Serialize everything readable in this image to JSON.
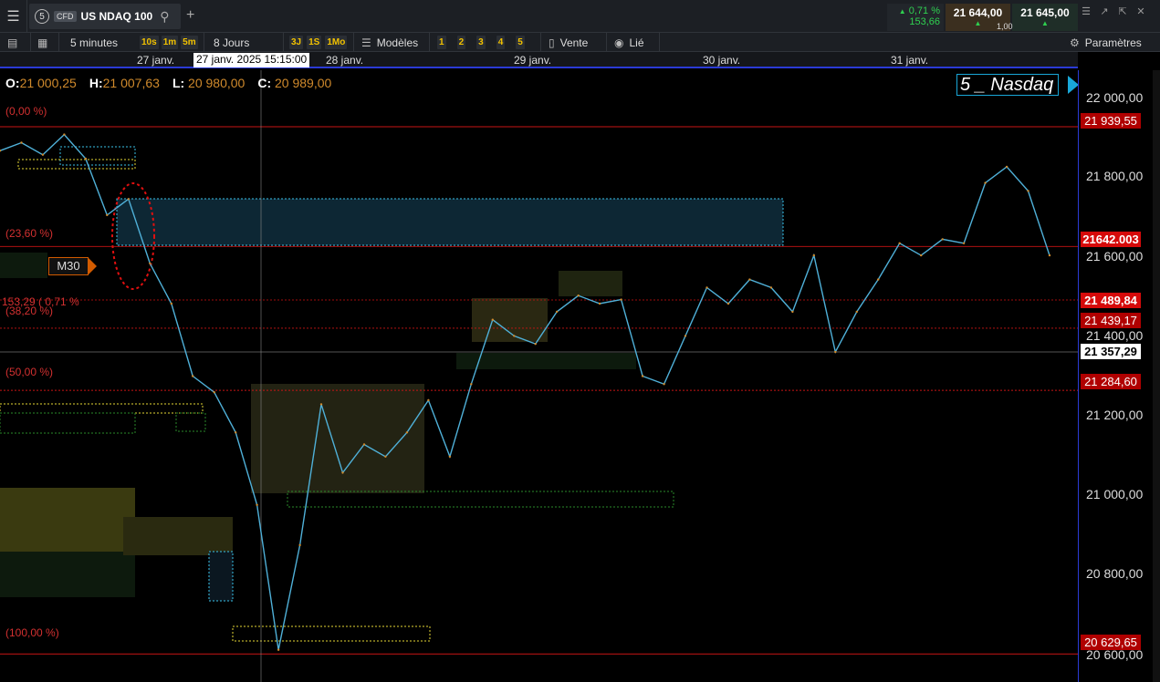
{
  "header": {
    "menu_icon": "hamburger-icon",
    "tab_number": "5",
    "tab_badge": "CFD",
    "instrument": "US NDAQ 100",
    "change_pct": "0,71 %",
    "change_pts": "153,66",
    "bid": "21 644,00",
    "ask": "21 645,00",
    "spread": "1,00"
  },
  "toolbar": {
    "interval": "5 minutes",
    "interval_shortcuts": [
      "10s",
      "1m",
      "5m"
    ],
    "period": "8 Jours",
    "period_shortcuts": [
      "3J",
      "1S",
      "1Mo"
    ],
    "templates": "Modèles",
    "template_slots": [
      "1",
      "2",
      "3",
      "4",
      "5"
    ],
    "sell": "Vente",
    "linked": "Lié",
    "settings": "Paramètres"
  },
  "date_axis": {
    "labels": [
      "27 janv.",
      "28 janv.",
      "29 janv.",
      "30 janv.",
      "31 janv."
    ],
    "cursor": "27 janv. 2025 15:15:00"
  },
  "ohlc": {
    "o_label": "O:",
    "o_value": "21 000,25",
    "h_label": "H:",
    "h_value": "21 007,63",
    "l_label": "L:",
    "l_value": "20 980,00",
    "c_label": "C:",
    "c_value": "20 989,00"
  },
  "annotations": {
    "watermark": "5 _  Nasdaq",
    "timeframe_tag": "M30",
    "change_label": "153,29 ( 0,71 %"
  },
  "fibonacci": [
    "(0,00 %)",
    "(23,60 %)",
    "(38,20 %)",
    "(50,00 %)",
    "(100,00 %)"
  ],
  "price_axis": {
    "ticks": [
      "22 000,00",
      "21 800,00",
      "21 600,00",
      "21 400,00",
      "21 200,00",
      "21 000,00",
      "20 800,00",
      "20 600,00"
    ],
    "tags": [
      "21 939,55",
      "21642.003",
      "21 489,84",
      "21 439,17",
      "21 357,29",
      "21 284,60",
      "20 629,65"
    ]
  },
  "chart_data": {
    "type": "line",
    "title": "US NDAQ 100",
    "interval": "5 minutes",
    "ylim": [
      20560,
      22080
    ],
    "x": [
      "27 janv.",
      "28 janv.",
      "29 janv.",
      "30 janv.",
      "31 janv."
    ],
    "series": [
      {
        "values": [
          21880,
          21900,
          21870,
          21920,
          21860,
          21720,
          21760,
          21600,
          21500,
          21320,
          21280,
          21180,
          21000,
          20640,
          20900,
          21250,
          21080,
          21150,
          21120,
          21180,
          21260,
          21120,
          21300,
          21460,
          21420,
          21400,
          21480,
          21520,
          21500,
          21510,
          21320,
          21300,
          21420,
          21540,
          21500,
          21560,
          21540,
          21480,
          21620,
          21380,
          21480,
          21560,
          21650,
          21620,
          21660,
          21650,
          21800,
          21840,
          21780,
          21620
        ]
      }
    ],
    "levels": [
      {
        "label": "(0,00 %)",
        "value": 21939.55
      },
      {
        "label": "(23,60 %)",
        "value": 21642.0
      },
      {
        "label": "(38,20 %)",
        "value": 21439.17
      },
      {
        "label": "(50,00 %)",
        "value": 21284.6
      },
      {
        "label": "(100,00 %)",
        "value": 20629.65
      }
    ]
  }
}
